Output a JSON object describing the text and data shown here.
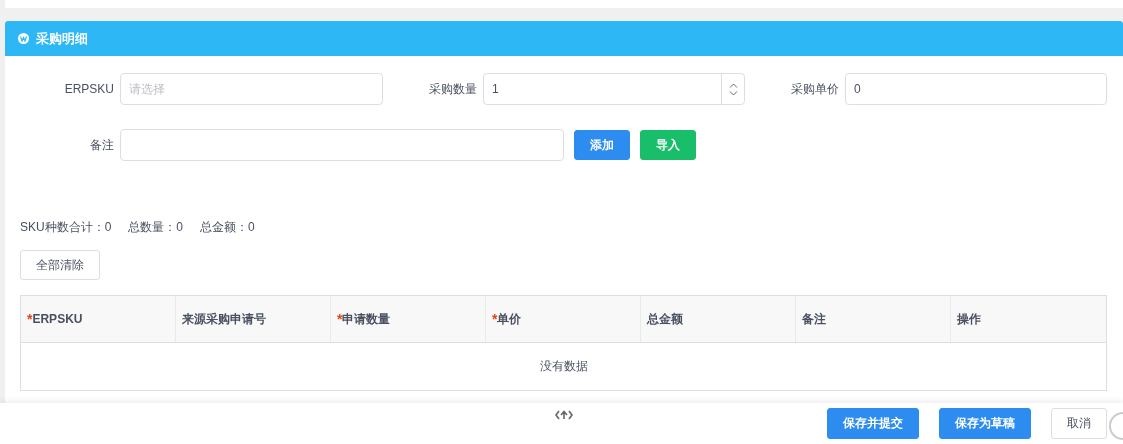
{
  "panel": {
    "title": "采购明细"
  },
  "form": {
    "row1": [
      {
        "kind": "text",
        "label": "ERPSKU",
        "placeholder": "请选择"
      },
      {
        "kind": "number",
        "label": "采购数量",
        "value": "1"
      },
      {
        "kind": "text",
        "label": "采购单价",
        "value": "0"
      }
    ],
    "remark": {
      "label": "备注"
    },
    "buttons": [
      {
        "label": "添加",
        "kind": "primary"
      },
      {
        "label": "导入",
        "kind": "success"
      }
    ]
  },
  "summary": [
    "SKU种数合计：0",
    "总数量：0",
    "总金额：0"
  ],
  "clear_button": "全部清除",
  "table": {
    "columns": [
      {
        "mark": "*",
        "label": "ERPSKU"
      },
      {
        "label": "来源采购申请号"
      },
      {
        "mark": "*",
        "label": "申请数量"
      },
      {
        "mark": "*",
        "label": "单价"
      },
      {
        "label": "总金额"
      },
      {
        "label": "备注"
      },
      {
        "label": "操作"
      }
    ],
    "empty_text": "没有数据"
  },
  "footer": {
    "buttons": [
      {
        "label": "保存并提交",
        "kind": "primary"
      },
      {
        "label": "保存为草稿",
        "kind": "primary"
      },
      {
        "label": "取消",
        "kind": "default"
      }
    ]
  }
}
